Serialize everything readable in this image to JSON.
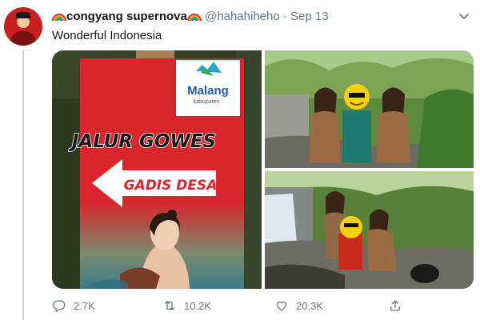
{
  "tweet": {
    "display_name": "congyang supernova",
    "handle": "@hahahiheho",
    "separator": "·",
    "date": "Sep 13",
    "text": "Wonderful Indonesia"
  },
  "media": {
    "sign": {
      "logo_name": "Malang",
      "logo_sub": "kabupaten",
      "heading": "JALUR GOWES",
      "arrow_label": "GADIS DESA"
    }
  },
  "actions": {
    "replies": "2.7K",
    "retweets": "10.2K",
    "likes": "20.3K"
  },
  "colors": {
    "sign_red": "#d8262c",
    "text_secondary": "#657786",
    "thread_line": "#ccd6dd"
  },
  "icons": [
    "rainbow-icon",
    "caret-down-icon",
    "reply-icon",
    "retweet-icon",
    "like-icon",
    "share-icon"
  ]
}
